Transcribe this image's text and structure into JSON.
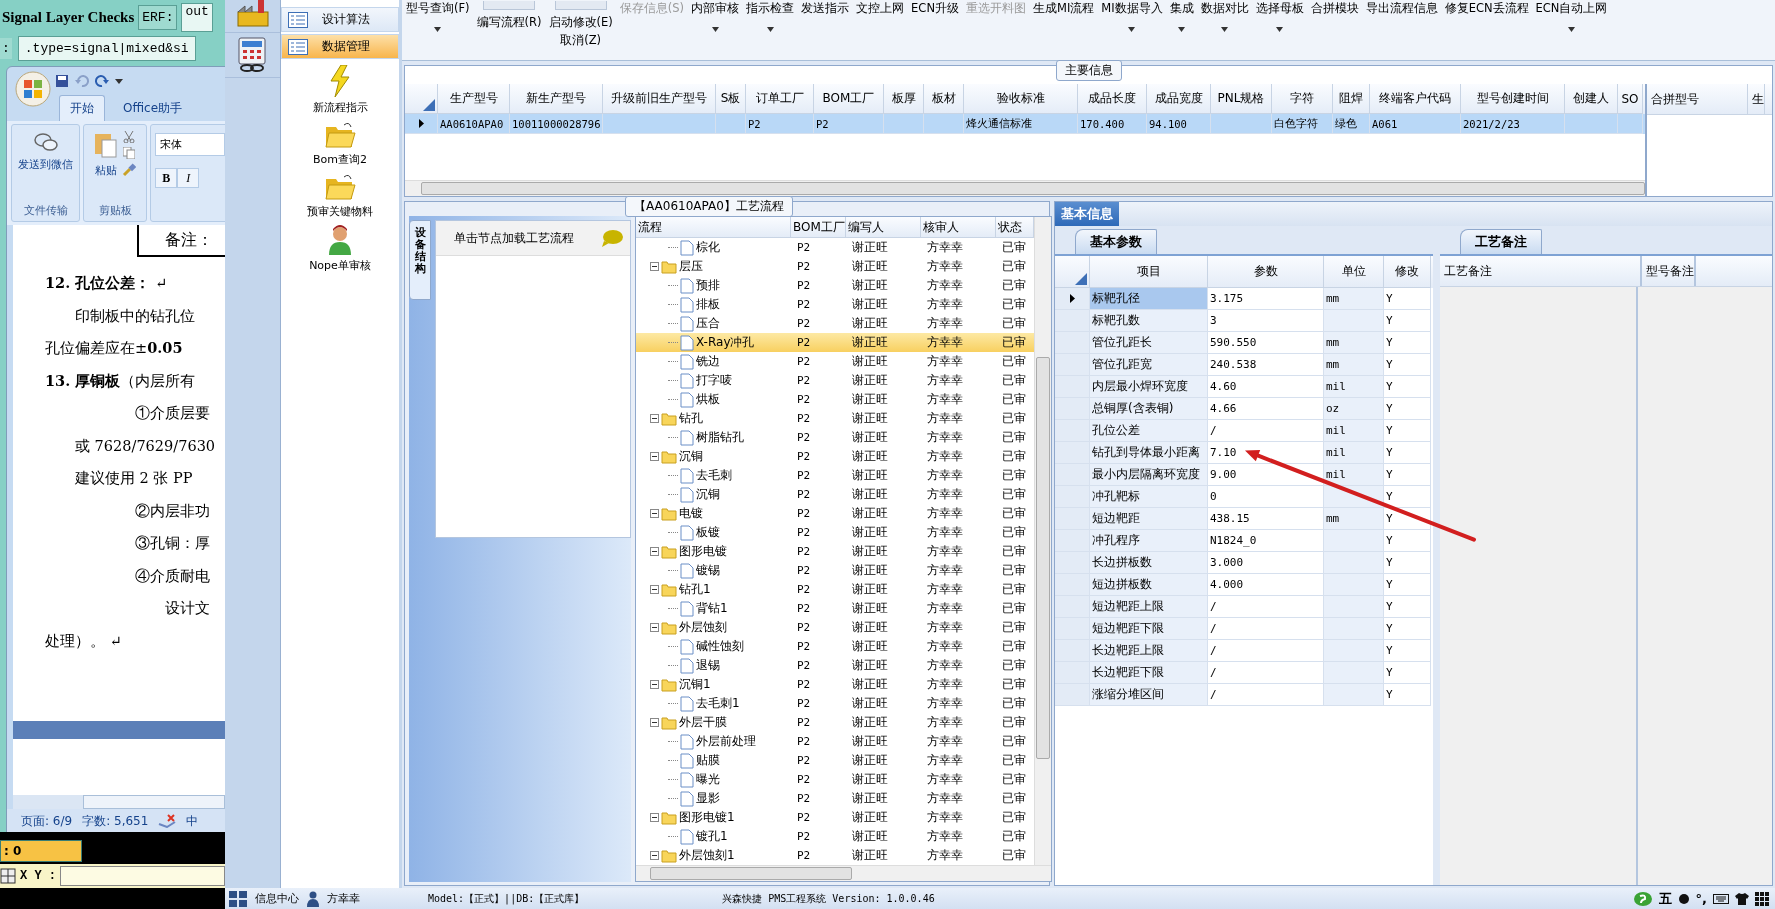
{
  "signal_window": {
    "title": "Signal Layer Checks",
    "erf_label": "ERF:",
    "out_value": "out",
    "filter_label": ":",
    "filter_value": ".type=signal|mixed&si"
  },
  "word": {
    "tabs": [
      {
        "label": "开始",
        "selected": true
      },
      {
        "label": "Office助手",
        "selected": false
      }
    ],
    "ribbon": {
      "wechat_button": "发送到微信",
      "file_group": "文件传输",
      "paste_button": "粘贴",
      "clipboard_group": "剪贴板",
      "font_name": "宋体",
      "bold": "B",
      "italic": "I"
    },
    "note": "备注：",
    "paragraphs": [
      {
        "kind": "heading",
        "text": "**12. 孔位公差：** ↵"
      },
      {
        "kind": "indent",
        "text": "印制板中的钻孔位"
      },
      {
        "kind": "plain",
        "text": "孔位偏差应在±**0.05**"
      },
      {
        "kind": "heading",
        "text": "**13. 厚铜板**（内层所有"
      },
      {
        "kind": "item",
        "text": "①介质层要"
      },
      {
        "kind": "indent",
        "text": "或 7628/7629/7630"
      },
      {
        "kind": "indent",
        "text": "建议使用 2 张 PP"
      },
      {
        "kind": "item",
        "text": "②内层非功"
      },
      {
        "kind": "item",
        "text": "③孔铜：厚"
      },
      {
        "kind": "item",
        "text": "④介质耐电"
      },
      {
        "kind": "sub",
        "text": "设计文"
      },
      {
        "kind": "plain",
        "text": "处理）。 ↵"
      }
    ],
    "status": {
      "page": "页面: 6/9",
      "words": "字数: 5,651",
      "language": "中"
    }
  },
  "coord_value": ": 0",
  "xy_label": "X Y :",
  "nav": {
    "items": [
      {
        "label": "设计算法",
        "selected": false
      },
      {
        "label": "数据管理",
        "selected": true
      }
    ],
    "shortcuts": [
      {
        "label": "新流程指示",
        "kind": "bolt"
      },
      {
        "label": "Bom查询2",
        "kind": "folder"
      },
      {
        "label": "预审关键物料",
        "kind": "folder"
      },
      {
        "label": "Nope单审核",
        "kind": "person"
      }
    ]
  },
  "toolbar": {
    "items": [
      {
        "label": "型号查询(F)",
        "kind": "text",
        "dropdown": true,
        "disabled": false
      },
      {
        "label": "编写流程(R)",
        "kind": "icon",
        "dropdown": false,
        "disabled": false
      },
      {
        "label": "启动修改(E)",
        "sublabel": "取消(Z)",
        "kind": "icon",
        "dropdown": false,
        "disabled": false
      },
      {
        "label": "保存信息(S)",
        "kind": "text",
        "dropdown": false,
        "disabled": true
      },
      {
        "label": "内部审核",
        "kind": "text",
        "dropdown": true,
        "disabled": false
      },
      {
        "label": "指示检查",
        "kind": "text",
        "dropdown": true,
        "disabled": false
      },
      {
        "label": "发送指示",
        "kind": "text",
        "dropdown": false,
        "disabled": false
      },
      {
        "label": "文控上网",
        "kind": "text",
        "dropdown": false,
        "disabled": false
      },
      {
        "label": "ECN升级",
        "kind": "text",
        "dropdown": false,
        "disabled": false
      },
      {
        "label": "重选开料图",
        "kind": "text",
        "dropdown": false,
        "disabled": true
      },
      {
        "label": "生成MI流程",
        "kind": "text",
        "dropdown": false,
        "disabled": false
      },
      {
        "label": "MI数据导入",
        "kind": "text",
        "dropdown": true,
        "disabled": false
      },
      {
        "label": "集成",
        "kind": "text",
        "dropdown": true,
        "disabled": false
      },
      {
        "label": "数据对比",
        "kind": "text",
        "dropdown": true,
        "disabled": false
      },
      {
        "label": "选择母板",
        "kind": "text",
        "dropdown": true,
        "disabled": false
      },
      {
        "label": "合拼模块",
        "kind": "text",
        "dropdown": false,
        "disabled": false
      },
      {
        "label": "导出流程信息",
        "kind": "text",
        "dropdown": false,
        "disabled": false
      },
      {
        "label": "修复ECN丢流程",
        "kind": "text",
        "dropdown": false,
        "disabled": false
      },
      {
        "label": "ECN自动上网",
        "kind": "text",
        "dropdown": true,
        "disabled": false
      }
    ]
  },
  "main_info": {
    "title": "主要信息",
    "columns": [
      "生产型号",
      "新生产型号",
      "升级前旧生产型号",
      "S板",
      "订单工厂",
      "BOM工厂",
      "板厚",
      "板材",
      "验收标准",
      "成品长度",
      "成品宽度",
      "PNL规格",
      "字符",
      "阻焊",
      "终端客户代码",
      "型号创建时间",
      "创建人",
      "SO"
    ],
    "rows": [
      {
        "selected": true,
        "cells": [
          "AA0610APA0",
          "10011000028796",
          "",
          "",
          "P2",
          "P2",
          "",
          "",
          "烽火通信标准",
          "170.400",
          "94.100",
          "",
          "白色字符",
          "绿色",
          "A061",
          "2021/2/23",
          "",
          ""
        ]
      }
    ],
    "merge_columns": [
      "合拼型号",
      "生"
    ]
  },
  "process": {
    "side_tab": "设备结构",
    "hint": "单击节点加载工艺流程",
    "title": "【AA0610APA0】工艺流程",
    "columns": [
      "流程",
      "BOM工厂",
      "编写人",
      "核审人",
      "状态"
    ],
    "nodes": [
      {
        "kind": "file",
        "label": "棕化",
        "bom": "P2",
        "writer": "谢正旺",
        "reviewer": "方幸幸",
        "status": "已审",
        "selected": false
      },
      {
        "kind": "folder",
        "label": "层压",
        "expanded": true,
        "bom": "P2",
        "writer": "谢正旺",
        "reviewer": "方幸幸",
        "status": "已审",
        "selected": false,
        "children": [
          {
            "kind": "file",
            "label": "预排",
            "bom": "P2",
            "writer": "谢正旺",
            "reviewer": "方幸幸",
            "status": "已审",
            "selected": false
          },
          {
            "kind": "file",
            "label": "排板",
            "bom": "P2",
            "writer": "谢正旺",
            "reviewer": "方幸幸",
            "status": "已审",
            "selected": false
          },
          {
            "kind": "file",
            "label": "压合",
            "bom": "P2",
            "writer": "谢正旺",
            "reviewer": "方幸幸",
            "status": "已审",
            "selected": false
          },
          {
            "kind": "file",
            "label": "X-Ray冲孔",
            "bom": "P2",
            "writer": "谢正旺",
            "reviewer": "方幸幸",
            "status": "已审",
            "selected": true
          },
          {
            "kind": "file",
            "label": "铣边",
            "bom": "P2",
            "writer": "谢正旺",
            "reviewer": "方幸幸",
            "status": "已审",
            "selected": false
          },
          {
            "kind": "file",
            "label": "打字唛",
            "bom": "P2",
            "writer": "谢正旺",
            "reviewer": "方幸幸",
            "status": "已审",
            "selected": false
          },
          {
            "kind": "file",
            "label": "烘板",
            "bom": "P2",
            "writer": "谢正旺",
            "reviewer": "方幸幸",
            "status": "已审",
            "selected": false
          }
        ]
      },
      {
        "kind": "folder",
        "label": "钻孔",
        "expanded": true,
        "bom": "P2",
        "writer": "谢正旺",
        "reviewer": "方幸幸",
        "status": "已审",
        "selected": false,
        "children": [
          {
            "kind": "file",
            "label": "树脂钻孔",
            "bom": "P2",
            "writer": "谢正旺",
            "reviewer": "方幸幸",
            "status": "已审",
            "selected": false
          }
        ]
      },
      {
        "kind": "folder",
        "label": "沉铜",
        "expanded": true,
        "bom": "P2",
        "writer": "谢正旺",
        "reviewer": "方幸幸",
        "status": "已审",
        "selected": false,
        "children": [
          {
            "kind": "file",
            "label": "去毛刺",
            "bom": "P2",
            "writer": "谢正旺",
            "reviewer": "方幸幸",
            "status": "已审",
            "selected": false
          },
          {
            "kind": "file",
            "label": "沉铜",
            "bom": "P2",
            "writer": "谢正旺",
            "reviewer": "方幸幸",
            "status": "已审",
            "selected": false
          }
        ]
      },
      {
        "kind": "folder",
        "label": "电镀",
        "expanded": true,
        "bom": "P2",
        "writer": "谢正旺",
        "reviewer": "方幸幸",
        "status": "已审",
        "selected": false,
        "children": [
          {
            "kind": "file",
            "label": "板镀",
            "bom": "P2",
            "writer": "谢正旺",
            "reviewer": "方幸幸",
            "status": "已审",
            "selected": false
          }
        ]
      },
      {
        "kind": "folder",
        "label": "图形电镀",
        "expanded": true,
        "bom": "P2",
        "writer": "谢正旺",
        "reviewer": "方幸幸",
        "status": "已审",
        "selected": false,
        "children": [
          {
            "kind": "file",
            "label": "镀锡",
            "bom": "P2",
            "writer": "谢正旺",
            "reviewer": "方幸幸",
            "status": "已审",
            "selected": false
          }
        ]
      },
      {
        "kind": "folder",
        "label": "钻孔1",
        "expanded": true,
        "bom": "P2",
        "writer": "谢正旺",
        "reviewer": "方幸幸",
        "status": "已审",
        "selected": false,
        "children": [
          {
            "kind": "file",
            "label": "背钻1",
            "bom": "P2",
            "writer": "谢正旺",
            "reviewer": "方幸幸",
            "status": "已审",
            "selected": false
          }
        ]
      },
      {
        "kind": "folder",
        "label": "外层蚀刻",
        "expanded": true,
        "bom": "P2",
        "writer": "谢正旺",
        "reviewer": "方幸幸",
        "status": "已审",
        "selected": false,
        "children": [
          {
            "kind": "file",
            "label": "碱性蚀刻",
            "bom": "P2",
            "writer": "谢正旺",
            "reviewer": "方幸幸",
            "status": "已审",
            "selected": false
          },
          {
            "kind": "file",
            "label": "退锡",
            "bom": "P2",
            "writer": "谢正旺",
            "reviewer": "方幸幸",
            "status": "已审",
            "selected": false
          }
        ]
      },
      {
        "kind": "folder",
        "label": "沉铜1",
        "expanded": true,
        "bom": "P2",
        "writer": "谢正旺",
        "reviewer": "方幸幸",
        "status": "已审",
        "selected": false,
        "children": [
          {
            "kind": "file",
            "label": "去毛刺1",
            "bom": "P2",
            "writer": "谢正旺",
            "reviewer": "方幸幸",
            "status": "已审",
            "selected": false
          }
        ]
      },
      {
        "kind": "folder",
        "label": "外层干膜",
        "expanded": true,
        "bom": "P2",
        "writer": "谢正旺",
        "reviewer": "方幸幸",
        "status": "已审",
        "selected": false,
        "children": [
          {
            "kind": "file",
            "label": "外层前处理",
            "bom": "P2",
            "writer": "谢正旺",
            "reviewer": "方幸幸",
            "status": "已审",
            "selected": false
          },
          {
            "kind": "file",
            "label": "贴膜",
            "bom": "P2",
            "writer": "谢正旺",
            "reviewer": "方幸幸",
            "status": "已审",
            "selected": false
          },
          {
            "kind": "file",
            "label": "曝光",
            "bom": "P2",
            "writer": "谢正旺",
            "reviewer": "方幸幸",
            "status": "已审",
            "selected": false
          },
          {
            "kind": "file",
            "label": "显影",
            "bom": "P2",
            "writer": "谢正旺",
            "reviewer": "方幸幸",
            "status": "已审",
            "selected": false
          }
        ]
      },
      {
        "kind": "folder",
        "label": "图形电镀1",
        "expanded": true,
        "bom": "P2",
        "writer": "谢正旺",
        "reviewer": "方幸幸",
        "status": "已审",
        "selected": false,
        "children": [
          {
            "kind": "file",
            "label": "镀孔1",
            "bom": "P2",
            "writer": "谢正旺",
            "reviewer": "方幸幸",
            "status": "已审",
            "selected": false
          }
        ]
      },
      {
        "kind": "folder",
        "label": "外层蚀刻1",
        "expanded": true,
        "bom": "P2",
        "writer": "谢正旺",
        "reviewer": "方幸幸",
        "status": "已审",
        "selected": false
      }
    ]
  },
  "params": {
    "tab": {
      "label": "基本信息",
      "selected": true
    },
    "subtab": "基本参数",
    "columns": [
      "项目",
      "参数",
      "单位",
      "修改"
    ],
    "rows": [
      {
        "item": "标靶孔径",
        "value": "3.175",
        "unit": "mm",
        "modify": "Y",
        "selected": true
      },
      {
        "item": "标靶孔数",
        "value": "3",
        "unit": "",
        "modify": "Y",
        "selected": false
      },
      {
        "item": "管位孔距长",
        "value": "590.550",
        "unit": "mm",
        "modify": "Y",
        "selected": false
      },
      {
        "item": "管位孔距宽",
        "value": "240.538",
        "unit": "mm",
        "modify": "Y",
        "selected": false
      },
      {
        "item": "内层最小焊环宽度",
        "value": "4.60",
        "unit": "mil",
        "modify": "Y",
        "selected": false
      },
      {
        "item": "总铜厚(含表铜)",
        "value": "4.66",
        "unit": "oz",
        "modify": "Y",
        "selected": false
      },
      {
        "item": "孔位公差",
        "value": "/",
        "unit": "mil",
        "modify": "Y",
        "selected": false
      },
      {
        "item": "钻孔到导体最小距离",
        "value": "7.10",
        "unit": "mil",
        "modify": "Y",
        "selected": false
      },
      {
        "item": "最小内层隔离环宽度",
        "value": "9.00",
        "unit": "mil",
        "modify": "Y",
        "selected": false
      },
      {
        "item": "冲孔靶标",
        "value": "0",
        "unit": "",
        "modify": "Y",
        "selected": false
      },
      {
        "item": "短边靶距",
        "value": "438.15",
        "unit": "mm",
        "modify": "Y",
        "selected": false
      },
      {
        "item": "冲孔程序",
        "value": "N1824_0",
        "unit": "",
        "modify": "Y",
        "selected": false
      },
      {
        "item": "长边拼板数",
        "value": "3.000",
        "unit": "",
        "modify": "Y",
        "selected": false
      },
      {
        "item": "短边拼板数",
        "value": "4.000",
        "unit": "",
        "modify": "Y",
        "selected": false
      },
      {
        "item": "短边靶距上限",
        "value": "/",
        "unit": "",
        "modify": "Y",
        "selected": false
      },
      {
        "item": "短边靶距下限",
        "value": "/",
        "unit": "",
        "modify": "Y",
        "selected": false
      },
      {
        "item": "长边靶距上限",
        "value": "/",
        "unit": "",
        "modify": "Y",
        "selected": false
      },
      {
        "item": "长边靶距下限",
        "value": "/",
        "unit": "",
        "modify": "Y",
        "selected": false
      },
      {
        "item": "涨缩分堆区间",
        "value": "/",
        "unit": "",
        "modify": "Y",
        "selected": false
      }
    ]
  },
  "notes": {
    "tab": "工艺备注",
    "columns": [
      "工艺备注",
      "型号备注"
    ]
  },
  "status_bar": {
    "info_center": "信息中心",
    "user": "方幸幸",
    "model": "Model:【正式】||DB:【正式库】",
    "system": "兴森快捷 PMS工程系统 Version: 1.0.0.46",
    "ime_mode": "五",
    "punctuation": "°,"
  }
}
